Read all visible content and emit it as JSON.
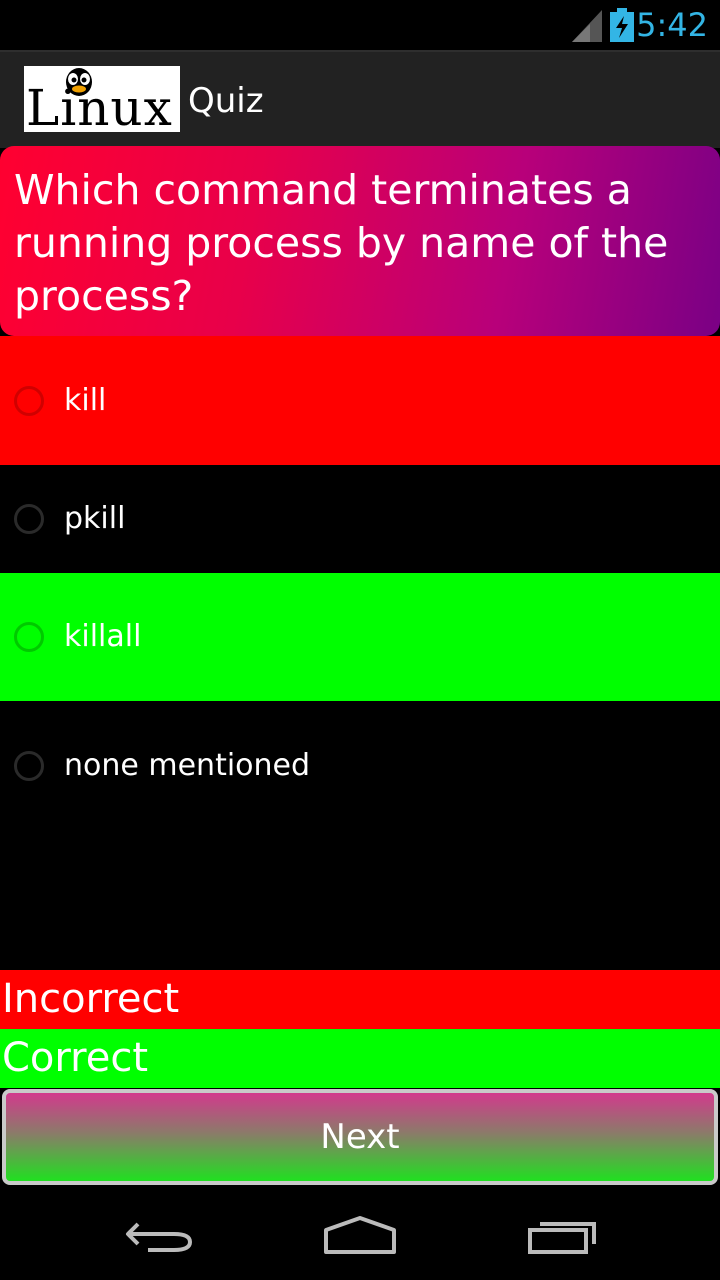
{
  "status_bar": {
    "time": "5:42",
    "accent_color": "#33b5e5",
    "icons": [
      "signal-icon",
      "battery-charging-icon"
    ]
  },
  "action_bar": {
    "logo_text": "Linux",
    "title": "Quiz"
  },
  "question": {
    "text": "Which command terminates a running process by name of the process?"
  },
  "options": [
    {
      "label": "kill",
      "state": "incorrect",
      "color": "#ff0000"
    },
    {
      "label": "pkill",
      "state": "neutral",
      "color": "#000000"
    },
    {
      "label": "killall",
      "state": "correct",
      "color": "#00ff00"
    },
    {
      "label": "none mentioned",
      "state": "neutral",
      "color": "#000000"
    }
  ],
  "results": {
    "incorrect_label": "Incorrect",
    "correct_label": "Correct"
  },
  "next_button": {
    "label": "Next"
  },
  "nav_bar": {
    "icons": [
      "back-icon",
      "home-icon",
      "recents-icon"
    ]
  }
}
